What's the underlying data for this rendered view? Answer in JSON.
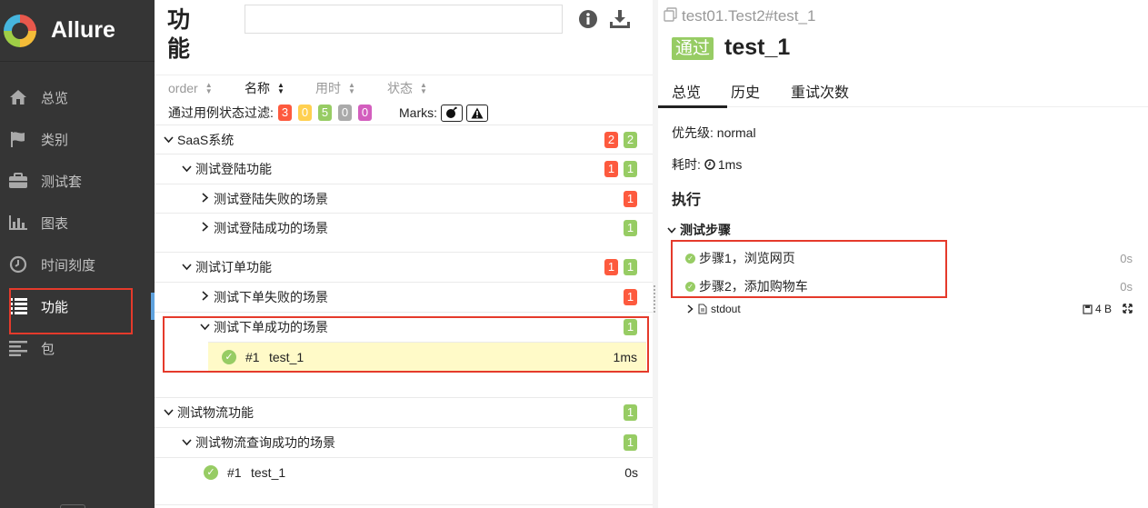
{
  "app": {
    "name": "Allure"
  },
  "sidebar": {
    "items": [
      {
        "label": "总览",
        "icon": "home-icon"
      },
      {
        "label": "类别",
        "icon": "flag-icon"
      },
      {
        "label": "测试套",
        "icon": "briefcase-icon"
      },
      {
        "label": "图表",
        "icon": "bar-chart-icon"
      },
      {
        "label": "时间刻度",
        "icon": "clock-icon"
      },
      {
        "label": "功能",
        "icon": "list-icon",
        "active": true
      },
      {
        "label": "包",
        "icon": "align-left-icon"
      }
    ]
  },
  "middle": {
    "title": "功能",
    "search": {
      "value": "",
      "placeholder": ""
    },
    "sort": {
      "order": "order",
      "name": "名称",
      "duration": "用时",
      "status": "状态"
    },
    "filter": {
      "label": "通过用例状态过滤:",
      "counts": [
        {
          "value": "3",
          "color": "#fd5a3e"
        },
        {
          "value": "0",
          "color": "#ffd050"
        },
        {
          "value": "5",
          "color": "#97cc64"
        },
        {
          "value": "0",
          "color": "#aaaaaa"
        },
        {
          "value": "0",
          "color": "#d35ebe"
        }
      ],
      "marks_label": "Marks:",
      "marks": [
        "bomb-icon",
        "warning-icon"
      ]
    },
    "tree": {
      "groups": [
        {
          "label": "SaaS系统",
          "badges": [
            {
              "value": "2",
              "color": "#fd5a3e"
            },
            {
              "value": "2",
              "color": "#97cc64"
            }
          ],
          "features": [
            {
              "label": "测试登陆功能",
              "badges": [
                {
                  "value": "1",
                  "color": "#fd5a3e"
                },
                {
                  "value": "1",
                  "color": "#97cc64"
                }
              ],
              "stories": [
                {
                  "label": "测试登陆失败的场景",
                  "badge": {
                    "value": "1",
                    "color": "#fd5a3e"
                  }
                },
                {
                  "label": "测试登陆成功的场景",
                  "badge": {
                    "value": "1",
                    "color": "#97cc64"
                  }
                }
              ]
            },
            {
              "label": "测试订单功能",
              "badges": [
                {
                  "value": "1",
                  "color": "#fd5a3e"
                },
                {
                  "value": "1",
                  "color": "#97cc64"
                }
              ],
              "stories": [
                {
                  "label": "测试下单失败的场景",
                  "badge": {
                    "value": "1",
                    "color": "#fd5a3e"
                  }
                },
                {
                  "label": "测试下单成功的场景",
                  "badge": {
                    "value": "1",
                    "color": "#97cc64"
                  },
                  "case": {
                    "num": "#1",
                    "name": "test_1",
                    "time": "1ms"
                  }
                }
              ]
            }
          ]
        },
        {
          "label": "测试物流功能",
          "badges": [
            {
              "value": "1",
              "color": "#97cc64"
            }
          ],
          "features": [
            {
              "label": "测试物流查询成功的场景",
              "badges": [
                {
                  "value": "1",
                  "color": "#97cc64"
                }
              ],
              "case": {
                "num": "#1",
                "name": "test_1",
                "time": "0s"
              }
            }
          ]
        }
      ]
    }
  },
  "detail": {
    "breadcrumb": "test01.Test2#test_1",
    "status": "通过",
    "title": "test_1",
    "tabs": [
      "总览",
      "历史",
      "重试次数"
    ],
    "severity": "优先级: normal",
    "duration_label": "耗时:",
    "duration": "1ms",
    "execution_title": "执行",
    "steps_title": "测试步骤",
    "steps": [
      {
        "label": "步骤1，浏览网页",
        "time": "0s"
      },
      {
        "label": "步骤2，添加购物车",
        "time": "0s"
      }
    ],
    "attachment": {
      "name": "stdout",
      "size": "4 B"
    }
  }
}
